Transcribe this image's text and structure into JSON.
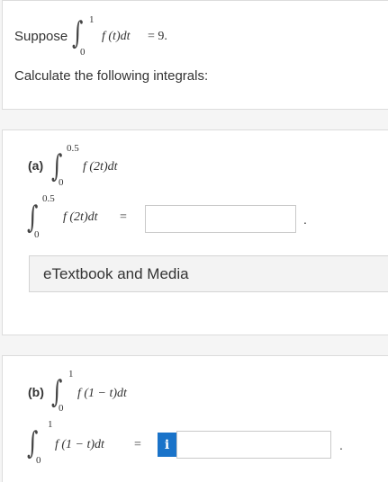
{
  "intro": {
    "suppose": "Suppose",
    "upper": "1",
    "lower": "0",
    "integrand": "f (t)dt",
    "equals": "= 9.",
    "instruction": "Calculate the following integrals:"
  },
  "part_a": {
    "label": "(a)",
    "upper": "0.5",
    "lower": "0",
    "integrand": "f (2t)dt",
    "eq_upper": "0.5",
    "eq_lower": "0",
    "eq_integrand": "f (2t)dt",
    "equals": "=",
    "answer_value": "",
    "period": ".",
    "media_label": "eTextbook and Media"
  },
  "part_b": {
    "label": "(b)",
    "upper": "1",
    "lower": "0",
    "integrand": "f (1 − t)dt",
    "eq_upper": "1",
    "eq_lower": "0",
    "eq_integrand": "f (1 − t)dt",
    "equals": "=",
    "info_icon_label": "i",
    "answer_value": "",
    "period": "."
  },
  "icons": {
    "info": "info-icon"
  }
}
